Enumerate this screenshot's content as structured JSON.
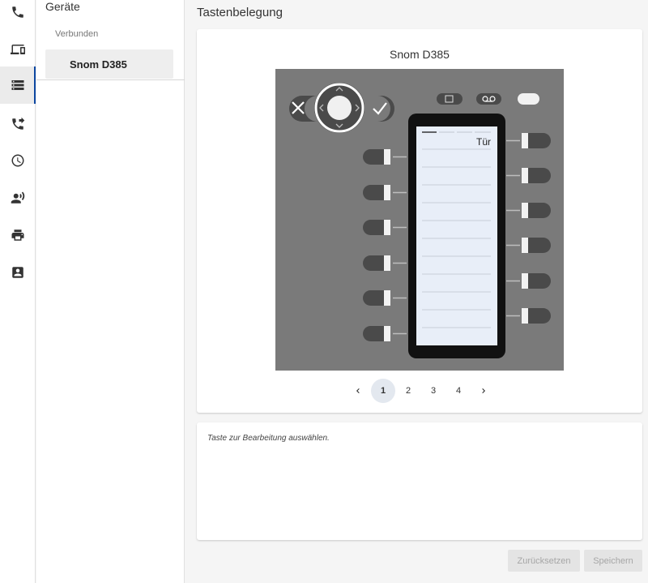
{
  "sidebar": {
    "title": "Geräte",
    "section_label": "Verbunden",
    "devices": [
      {
        "label": "Snom D385",
        "selected": true
      }
    ]
  },
  "rail": {
    "items": [
      {
        "icon": "phone-icon"
      },
      {
        "icon": "devices-icon"
      },
      {
        "icon": "server-icon",
        "active": true
      },
      {
        "icon": "call-forward-icon"
      },
      {
        "icon": "clock-icon"
      },
      {
        "icon": "record-voice-icon"
      },
      {
        "icon": "printer-icon"
      },
      {
        "icon": "contact-card-icon"
      }
    ]
  },
  "main": {
    "title": "Tastenbelegung",
    "phone_model": "Snom D385",
    "screen_keys": [
      {
        "label": ""
      },
      {
        "label": "Tür"
      },
      {
        "label": ""
      },
      {
        "label": ""
      },
      {
        "label": ""
      },
      {
        "label": ""
      },
      {
        "label": ""
      },
      {
        "label": ""
      },
      {
        "label": ""
      },
      {
        "label": ""
      },
      {
        "label": ""
      },
      {
        "label": ""
      }
    ],
    "pagination": {
      "pages": [
        "1",
        "2",
        "3",
        "4"
      ],
      "current": "1"
    },
    "edit_hint": "Taste zur Bearbeitung auswählen.",
    "reset_label": "Zurücksetzen",
    "save_label": "Speichern"
  },
  "colors": {
    "accent": "#0d47a1",
    "phone_body": "#7a7a7a",
    "screen": "#e8eef8",
    "key_dark": "#4a4a4a"
  }
}
